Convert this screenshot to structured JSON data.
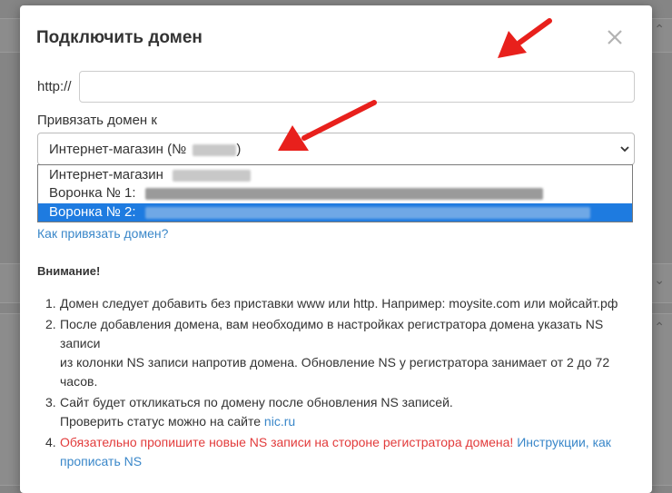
{
  "modal": {
    "title": "Подключить домен"
  },
  "form": {
    "http_prefix": "http://",
    "domain_value": "",
    "bind_label": "Привязать домен к",
    "selected_value": "Интернет-магазин (№",
    "selected_suffix": ")"
  },
  "dropdown": {
    "options": [
      {
        "label": "Интернет-магазин"
      },
      {
        "label": "Воронка № 1:"
      },
      {
        "label": "Воронка № 2:"
      }
    ]
  },
  "help_link": "Как привязать домен?",
  "notice": {
    "heading": "Внимание!",
    "steps": [
      {
        "num": "1.",
        "lines": [
          "Домен следует добавить без приставки www или http. Например: moysite.com или мойсайт.рф"
        ]
      },
      {
        "num": "2.",
        "lines": [
          "После добавления домена, вам необходимо в настройках регистратора домена указать NS",
          "записи",
          "из колонки NS записи напротив домена. Обновление NS у регистратора занимает от 2 до 72",
          "часов."
        ]
      },
      {
        "num": "3.",
        "lines": [
          "Сайт будет откликаться по домену после обновления NS записей.",
          "Проверить статус можно на сайте "
        ],
        "link": "nic.ru"
      },
      {
        "num": "4.",
        "red_text": "Обязательно пропишите новые NS записи на стороне регистратора домена!",
        "link_text": "Инструкции, как прописать NS"
      }
    ]
  },
  "colors": {
    "accent": "#1e7be0",
    "link": "#3a87c9",
    "warning": "#e23b3b",
    "arrow": "#e8201c"
  }
}
